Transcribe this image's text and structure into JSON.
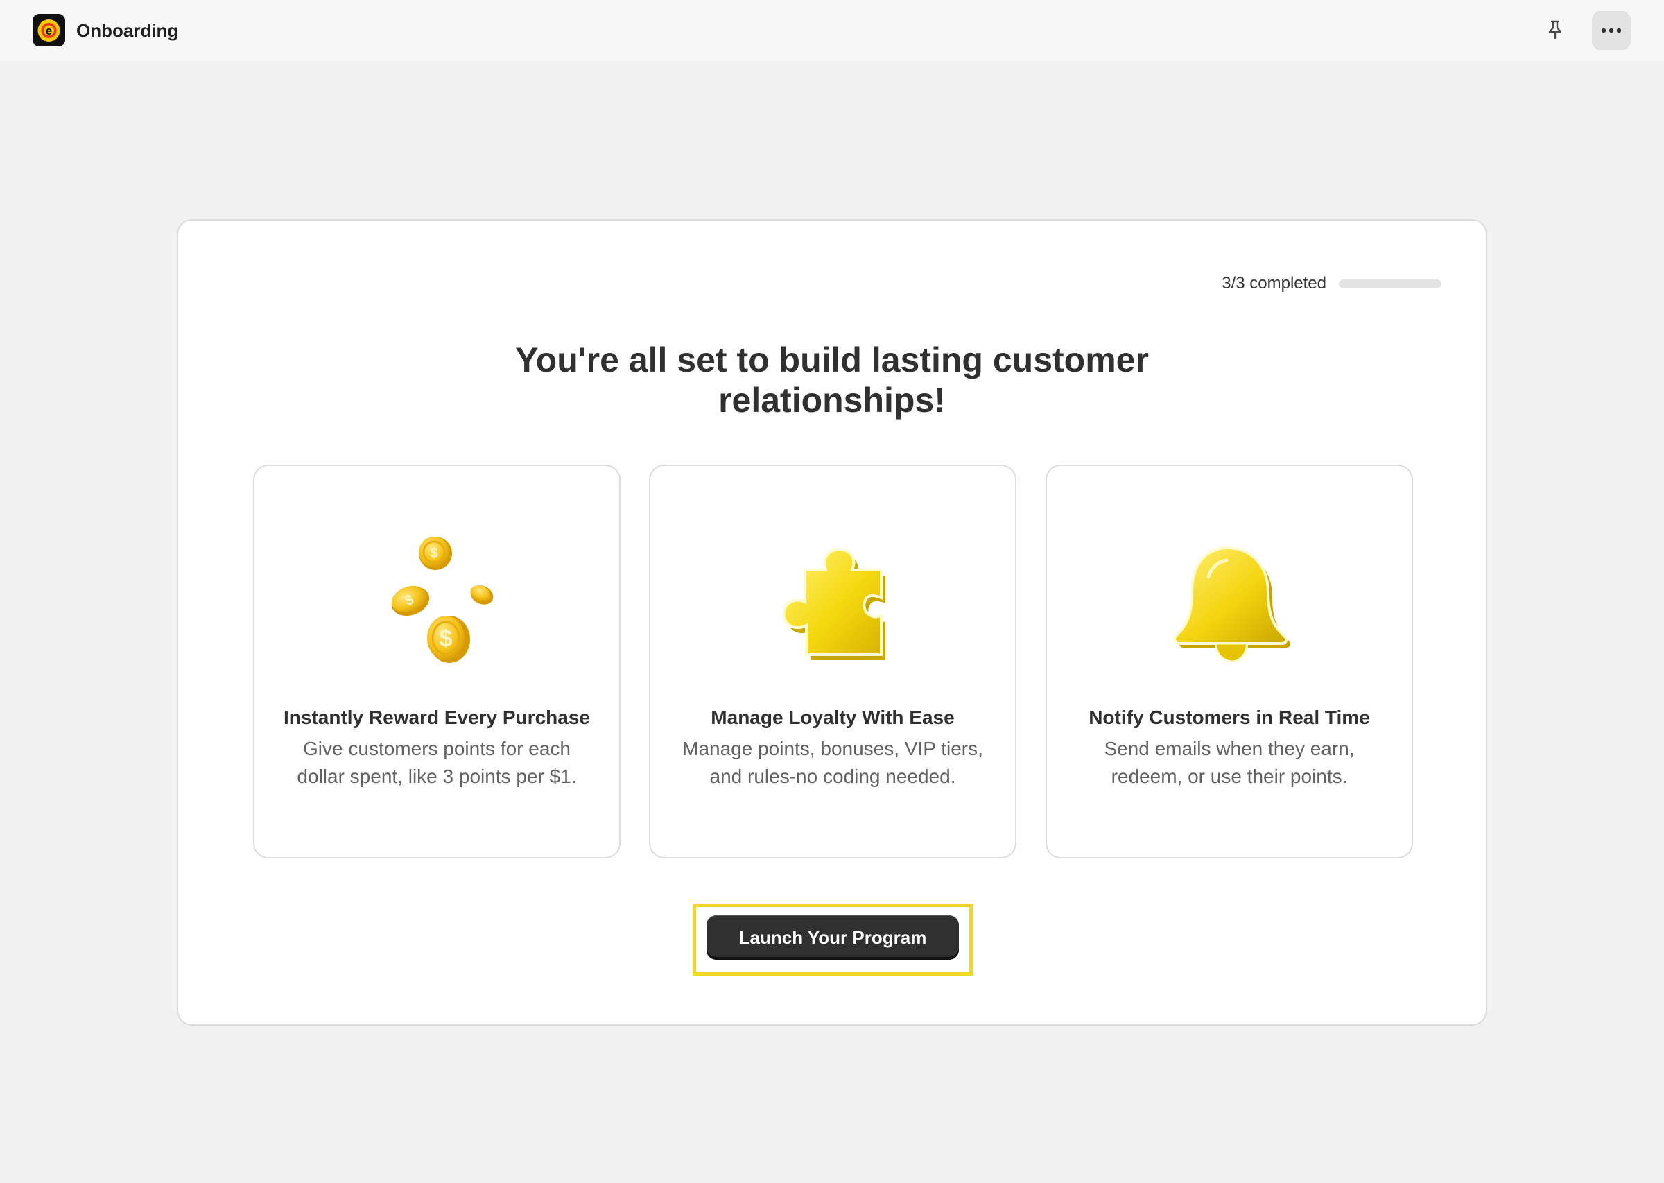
{
  "topbar": {
    "title": "Onboarding",
    "logo_icon": "app-logo-icon",
    "pin_icon": "pin-icon",
    "more_icon": "more-horizontal-icon"
  },
  "progress": {
    "label": "3/3 completed",
    "value": 1.0
  },
  "headline": {
    "line1": "You're all set to build lasting customer",
    "line2": "relationships!"
  },
  "features": [
    {
      "icon": "coins-icon",
      "title": "Instantly Reward Every Purchase",
      "desc_line1": "Give customers points for each",
      "desc_line2": "dollar spent, like 3 points per $1."
    },
    {
      "icon": "puzzle-piece-icon",
      "title": "Manage Loyalty With Ease",
      "desc_line1": "Manage points, bonuses, VIP tiers,",
      "desc_line2": "and rules-no coding needed."
    },
    {
      "icon": "bell-icon",
      "title": "Notify Customers in Real Time",
      "desc_line1": "Send emails when they earn,",
      "desc_line2": "redeem, or use their points."
    }
  ],
  "cta": {
    "label": "Launch Your Program"
  },
  "colors": {
    "accent_yellow": "#f0d72a",
    "button_dark": "#303030",
    "background": "#f1f1f1"
  }
}
